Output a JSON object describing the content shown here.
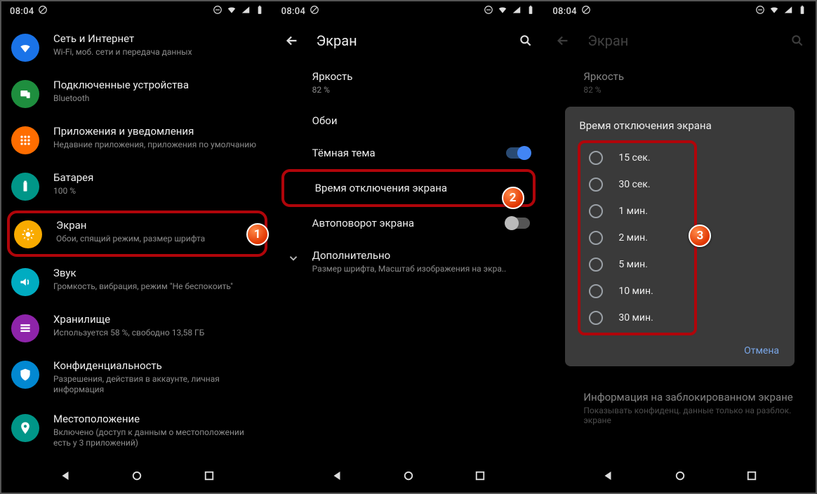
{
  "status": {
    "time": "08:04"
  },
  "panel1": {
    "items": [
      {
        "title": "Сеть и Интернет",
        "sub": "Wi-Fi, моб. сети и передача данных"
      },
      {
        "title": "Подключенные устройства",
        "sub": "Bluetooth"
      },
      {
        "title": "Приложения и уведомления",
        "sub": "Недавние приложения, приложения по умолчанию"
      },
      {
        "title": "Батарея",
        "sub": "100 %"
      },
      {
        "title": "Экран",
        "sub": "Обои, спящий режим, размер шрифта"
      },
      {
        "title": "Звук",
        "sub": "Громкость, вибрация, режим \"Не беспокоить\""
      },
      {
        "title": "Хранилище",
        "sub": "Используется 58 %, свободно 13,58 ГБ"
      },
      {
        "title": "Конфиденциальность",
        "sub": "Разрешения, действия в аккаунте, личная информация"
      },
      {
        "title": "Местоположение",
        "sub": "Включено (доступ к данным о местоположении есть у 3 приложений)"
      }
    ]
  },
  "panel2": {
    "title": "Экран",
    "brightness": {
      "label": "Яркость",
      "value": "82 %"
    },
    "wallpaper": {
      "label": "Обои"
    },
    "darktheme": {
      "label": "Тёмная тема"
    },
    "timeout": {
      "label": "Время отключения экрана"
    },
    "autorotate": {
      "label": "Автоповорот экрана"
    },
    "more": {
      "label": "Дополнительно",
      "sub": "Размер шрифта, Масштаб изображения на экра.."
    }
  },
  "panel3": {
    "title": "Экран",
    "brightness": {
      "label": "Яркость",
      "value": "82 %"
    },
    "dialog": {
      "title": "Время отключения экрана",
      "options": [
        "15 сек.",
        "30 сек.",
        "1 мин.",
        "2 мин.",
        "5 мин.",
        "10 мин.",
        "30 мин."
      ],
      "cancel": "Отмена"
    },
    "lockinfo": {
      "label": "Информация на заблокированном экране",
      "sub": "Показывать конфиденц. данные только на разблок. экране"
    }
  },
  "badges": [
    "1",
    "2",
    "3"
  ]
}
